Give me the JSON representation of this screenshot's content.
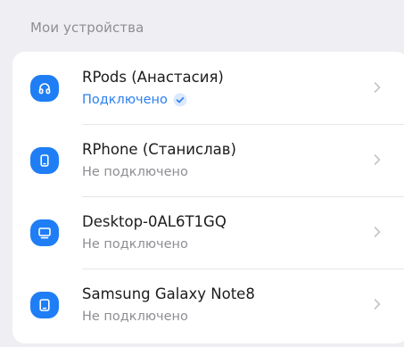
{
  "section": {
    "title": "Мои устройства"
  },
  "devices": [
    {
      "name": "RPods (Анастасия)",
      "status": "Подключено",
      "connected": true,
      "icon": "headphones-icon"
    },
    {
      "name": "RPhone (Станислав)",
      "status": "Не подключено",
      "connected": false,
      "icon": "phone-icon"
    },
    {
      "name": "Desktop-0AL6T1GQ",
      "status": "Не подключено",
      "connected": false,
      "icon": "monitor-icon"
    },
    {
      "name": "Samsung Galaxy Note8",
      "status": "Не подключено",
      "connected": false,
      "icon": "tablet-icon"
    }
  ],
  "colors": {
    "accent": "#1f7ef5",
    "connected_text": "#2a7ff0",
    "muted_text": "#8e8e93",
    "background": "#efeff3"
  }
}
